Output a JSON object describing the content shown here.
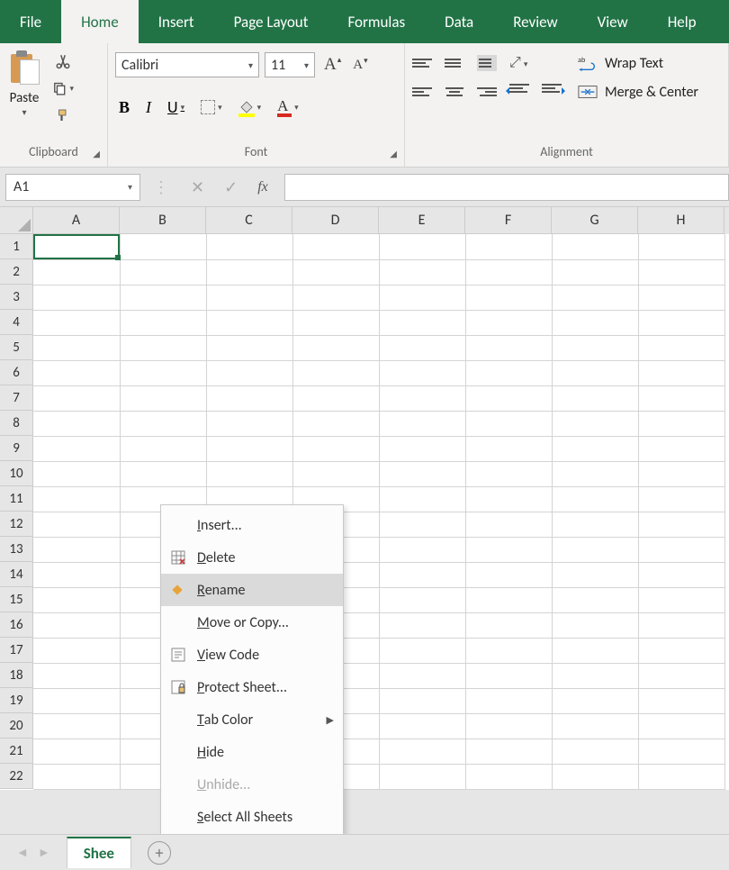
{
  "ribbon": {
    "tabs": [
      "File",
      "Home",
      "Insert",
      "Page Layout",
      "Formulas",
      "Data",
      "Review",
      "View",
      "Help"
    ],
    "active_tab": "Home",
    "groups": {
      "clipboard": {
        "label": "Clipboard",
        "paste": "Paste"
      },
      "font": {
        "label": "Font",
        "name": "Calibri",
        "size": "11",
        "bold": "B",
        "italic": "I",
        "underline": "U",
        "grow": "A",
        "shrink": "A"
      },
      "alignment": {
        "label": "Alignment",
        "wrap": "Wrap Text",
        "merge": "Merge & Center"
      }
    }
  },
  "formula_bar": {
    "name_box": "A1",
    "fx": "fx",
    "value": ""
  },
  "grid": {
    "columns": [
      "A",
      "B",
      "C",
      "D",
      "E",
      "F",
      "G",
      "H"
    ],
    "rows": [
      "1",
      "2",
      "3",
      "4",
      "5",
      "6",
      "7",
      "8",
      "9",
      "10",
      "11",
      "12",
      "13",
      "14",
      "15",
      "16",
      "17",
      "18",
      "19",
      "20",
      "21",
      "22"
    ],
    "active": "A1"
  },
  "sheet_bar": {
    "tab": "Shee",
    "nav_prev": "◄",
    "nav_next": "►",
    "new": "+"
  },
  "context_menu": {
    "items": [
      {
        "label_pre": "",
        "u": "I",
        "label_post": "nsert...",
        "icon": "",
        "sub": ""
      },
      {
        "label_pre": "",
        "u": "D",
        "label_post": "elete",
        "icon": "grid-x",
        "sub": ""
      },
      {
        "label_pre": "",
        "u": "R",
        "label_post": "ename",
        "icon": "diamond",
        "sub": "",
        "hover": true
      },
      {
        "label_pre": "",
        "u": "M",
        "label_post": "ove or Copy...",
        "icon": "",
        "sub": ""
      },
      {
        "label_pre": "",
        "u": "V",
        "label_post": "iew Code",
        "icon": "code",
        "sub": ""
      },
      {
        "label_pre": "",
        "u": "P",
        "label_post": "rotect Sheet...",
        "icon": "lock",
        "sub": ""
      },
      {
        "label_pre": "",
        "u": "T",
        "label_post": "ab Color",
        "icon": "",
        "sub": "▶"
      },
      {
        "label_pre": "",
        "u": "H",
        "label_post": "ide",
        "icon": "",
        "sub": ""
      },
      {
        "label_pre": "",
        "u": "U",
        "label_post": "nhide...",
        "icon": "",
        "sub": "",
        "disabled": true
      },
      {
        "label_pre": "",
        "u": "S",
        "label_post": "elect All Sheets",
        "icon": "",
        "sub": ""
      }
    ]
  }
}
